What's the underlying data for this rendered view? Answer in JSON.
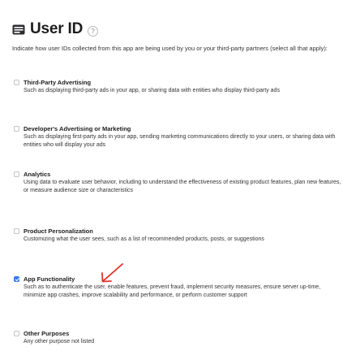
{
  "header": {
    "title": "User ID",
    "help_label": "?"
  },
  "intro": "Indicate how user IDs collected from this app are being used by you or your third-party partners (select all that apply):",
  "options": [
    {
      "title": "Third-Party Advertising",
      "description": "Such as displaying third-party ads in your app, or sharing data with entities who display third-party ads",
      "checked": false
    },
    {
      "title": "Developer's Advertising or Marketing",
      "description": "Such as displaying first-party ads in your app, sending marketing communications directly to your users, or sharing data with entities who will display your ads",
      "checked": false
    },
    {
      "title": "Analytics",
      "description": "Using data to evaluate user behavior, including to understand the effectiveness of existing product features, plan new features, or measure audience size or characteristics",
      "checked": false
    },
    {
      "title": "Product Personalization",
      "description": "Customizing what the user sees, such as a list of recommended products, posts, or suggestions",
      "checked": false
    },
    {
      "title": "App Functionality",
      "description": "Such as to authenticate the user, enable features, prevent fraud, implement security measures, ensure server up-time, minimize app crashes, improve scalability and performance, or perform customer support",
      "checked": true
    },
    {
      "title": "Other Purposes",
      "description": "Any other purpose not listed",
      "checked": false
    }
  ],
  "colors": {
    "accent": "#3478f6",
    "annotation": "#e0322b"
  }
}
